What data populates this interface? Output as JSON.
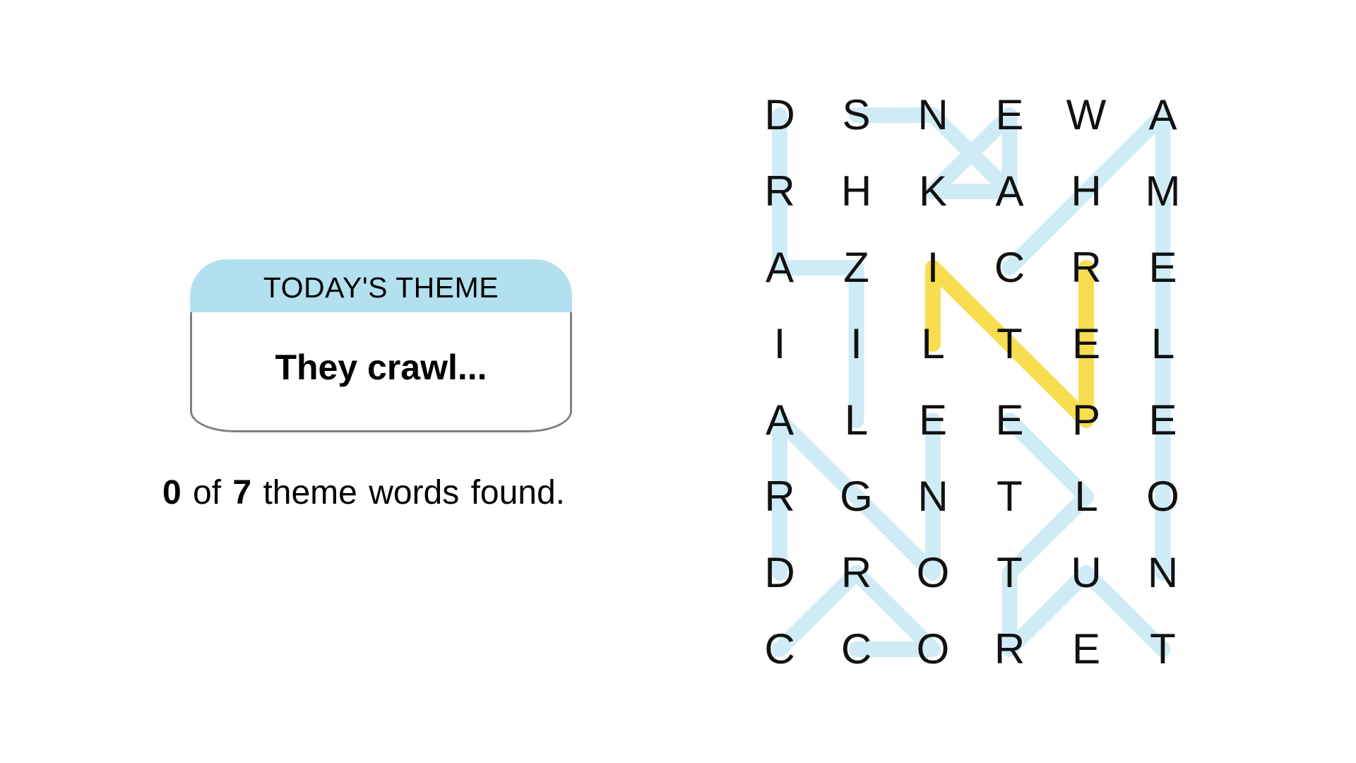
{
  "theme": {
    "header": "TODAY'S THEME",
    "clue": "They crawl...",
    "header_color": "#b3e0ef"
  },
  "progress": {
    "found": "0",
    "of_text": " of ",
    "total": "7",
    "suffix": " theme words found."
  },
  "grid": {
    "rows": [
      [
        "D",
        "S",
        "N",
        "E",
        "W",
        "A"
      ],
      [
        "R",
        "H",
        "K",
        "A",
        "H",
        "M"
      ],
      [
        "A",
        "Z",
        "I",
        "C",
        "R",
        "E"
      ],
      [
        "I",
        "I",
        "L",
        "T",
        "E",
        "L"
      ],
      [
        "A",
        "L",
        "E",
        "E",
        "P",
        "E"
      ],
      [
        "R",
        "G",
        "N",
        "T",
        "L",
        "O"
      ],
      [
        "D",
        "R",
        "O",
        "T",
        "U",
        "N"
      ],
      [
        "C",
        "C",
        "O",
        "R",
        "E",
        "T"
      ]
    ],
    "hint_color": "#a8dcee",
    "spangram_color": "#f7d733"
  }
}
